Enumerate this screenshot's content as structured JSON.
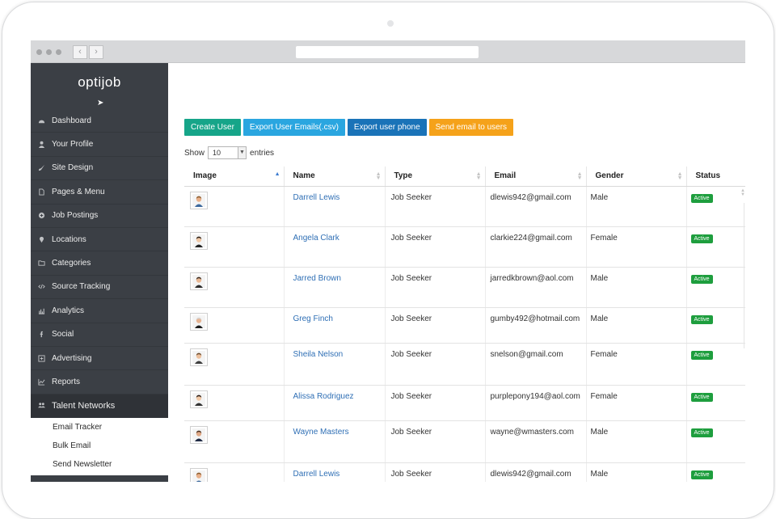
{
  "app": {
    "logo": "optijob"
  },
  "sidebar": {
    "items": [
      {
        "label": "Dashboard",
        "icon": "dashboard-icon"
      },
      {
        "label": "Your Profile",
        "icon": "user-icon"
      },
      {
        "label": "Site Design",
        "icon": "brush-icon"
      },
      {
        "label": "Pages & Menu",
        "icon": "page-icon"
      },
      {
        "label": "Job Postings",
        "icon": "plus-circle-icon"
      },
      {
        "label": "Locations",
        "icon": "location-pin-icon"
      },
      {
        "label": "Categories",
        "icon": "folder-icon"
      },
      {
        "label": "Source Tracking",
        "icon": "code-icon"
      },
      {
        "label": "Analytics",
        "icon": "bar-chart-icon"
      },
      {
        "label": "Social",
        "icon": "facebook-icon"
      },
      {
        "label": "Advertising",
        "icon": "advertising-icon"
      },
      {
        "label": "Reports",
        "icon": "line-chart-icon"
      },
      {
        "label": "Talent Networks",
        "icon": "users-icon"
      }
    ],
    "submenu": [
      "Email Tracker",
      "Bulk Email",
      "Send Newsletter"
    ]
  },
  "toolbar": {
    "create_user": "Create User",
    "export_emails": "Export User Emails(.csv)",
    "export_phone": "Export user phone",
    "send_email": "Send email to users"
  },
  "table_controls": {
    "show_label": "Show",
    "entries_value": "10",
    "entries_label": "entries"
  },
  "table": {
    "headers": [
      "Image",
      "Name",
      "Type",
      "Email",
      "Gender",
      "Status"
    ],
    "rows": [
      {
        "name": "Darrell Lewis",
        "type": "Job Seeker",
        "email": "dlewis942@gmail.com",
        "gender": "Male",
        "status": "Active"
      },
      {
        "name": "Angela Clark",
        "type": "Job Seeker",
        "email": "clarkie224@gmail.com",
        "gender": "Female",
        "status": "Active"
      },
      {
        "name": "Jarred Brown",
        "type": "Job Seeker",
        "email": "jarredkbrown@aol.com",
        "gender": "Male",
        "status": "Active"
      },
      {
        "name": "Greg Finch",
        "type": "Job Seeker",
        "email": "gumby492@hotmail.com",
        "gender": "Male",
        "status": "Active"
      },
      {
        "name": "Sheila Nelson",
        "type": "Job Seeker",
        "email": "snelson@gmail.com",
        "gender": "Female",
        "status": "Active"
      },
      {
        "name": "Alissa Rodriguez",
        "type": "Job Seeker",
        "email": "purplepony194@aol.com",
        "gender": "Female",
        "status": "Active"
      },
      {
        "name": "Wayne Masters",
        "type": "Job Seeker",
        "email": "wayne@wmasters.com",
        "gender": "Male",
        "status": "Active"
      },
      {
        "name": "Darrell Lewis",
        "type": "Job Seeker",
        "email": "dlewis942@gmail.com",
        "gender": "Male",
        "status": "Active"
      }
    ]
  },
  "colors": {
    "sidebar": "#3b3f45",
    "teal": "#16a589",
    "sky": "#2aa6e0",
    "blue": "#1a73b8",
    "orange": "#f5a21a",
    "active_badge": "#1e9e3e",
    "link": "#2f6fb5"
  }
}
